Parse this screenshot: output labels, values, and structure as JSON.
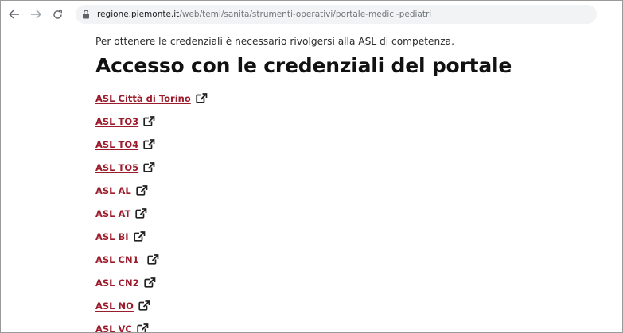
{
  "browser": {
    "url_host": "regione.piemonte.it",
    "url_path": "/web/temi/sanita/strumenti-operativi/portale-medici-pediatri",
    "icons": {
      "back": "arrow-left-icon",
      "forward": "arrow-right-icon",
      "reload": "reload-icon",
      "lock": "lock-icon"
    }
  },
  "page": {
    "intro_text": "Per ottenere le credenziali è necessario rivolgersi alla ASL di competenza.",
    "heading": "Accesso con le credenziali del portale",
    "link_color": "#9b1c2c",
    "asl_links": [
      {
        "label": "ASL Città di Torino",
        "icon": "external-link-icon"
      },
      {
        "label": "ASL TO3",
        "icon": "external-link-icon"
      },
      {
        "label": "ASL TO4",
        "icon": "external-link-icon"
      },
      {
        "label": "ASL TO5",
        "icon": "external-link-icon"
      },
      {
        "label": "ASL AL",
        "icon": "external-link-icon"
      },
      {
        "label": "ASL AT",
        "icon": "external-link-icon"
      },
      {
        "label": "ASL BI",
        "icon": "external-link-icon"
      },
      {
        "label": "ASL CN1 ",
        "icon": "external-link-icon"
      },
      {
        "label": "ASL CN2",
        "icon": "external-link-icon"
      },
      {
        "label": "ASL NO",
        "icon": "external-link-icon"
      },
      {
        "label": "ASL VC",
        "icon": "external-link-icon"
      }
    ]
  }
}
